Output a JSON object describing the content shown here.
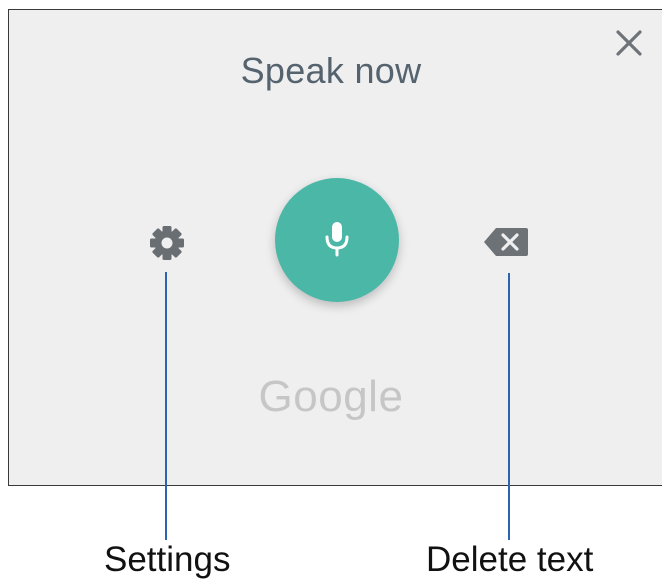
{
  "dialog": {
    "title": "Speak now",
    "brand": "Google",
    "accent_color": "#4bb7a7",
    "icons": {
      "close": "close-icon",
      "settings": "gear-icon",
      "microphone": "microphone-icon",
      "delete": "backspace-icon"
    }
  },
  "callouts": {
    "settings": "Settings",
    "delete": "Delete text"
  }
}
